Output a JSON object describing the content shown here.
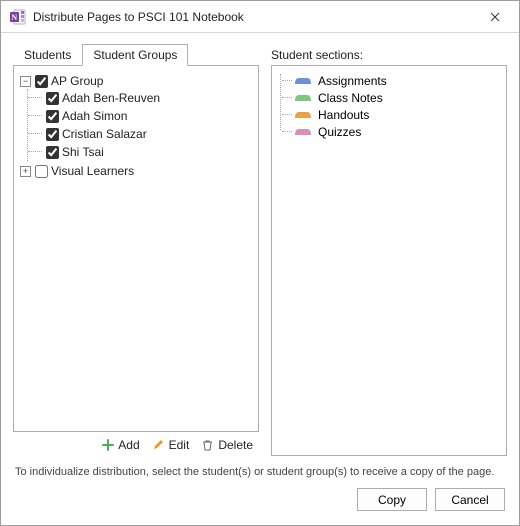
{
  "window": {
    "title": "Distribute Pages to PSCI 101 Notebook",
    "app_icon": "onenote-icon"
  },
  "tabs": {
    "students": "Students",
    "student_groups": "Student Groups",
    "active": "student_groups"
  },
  "tree": {
    "groups": [
      {
        "label": "AP Group",
        "expanded": true,
        "checked": true,
        "children": [
          {
            "label": "Adah Ben-Reuven",
            "checked": true
          },
          {
            "label": "Adah Simon",
            "checked": true
          },
          {
            "label": "Cristian Salazar",
            "checked": true
          },
          {
            "label": "Shi Tsai",
            "checked": true
          }
        ]
      },
      {
        "label": "Visual Learners",
        "expanded": false,
        "checked": false,
        "children": []
      }
    ]
  },
  "actions": {
    "add": "Add",
    "edit": "Edit",
    "delete": "Delete"
  },
  "sections": {
    "label": "Student sections:",
    "items": [
      {
        "label": "Assignments",
        "color": "#6f8fd6"
      },
      {
        "label": "Class Notes",
        "color": "#7fc77f"
      },
      {
        "label": "Handouts",
        "color": "#e7a24a"
      },
      {
        "label": "Quizzes",
        "color": "#d98fb5"
      }
    ]
  },
  "footer": {
    "note": "To individualize distribution, select the student(s) or student group(s) to receive a copy of the page.",
    "copy": "Copy",
    "cancel": "Cancel"
  }
}
